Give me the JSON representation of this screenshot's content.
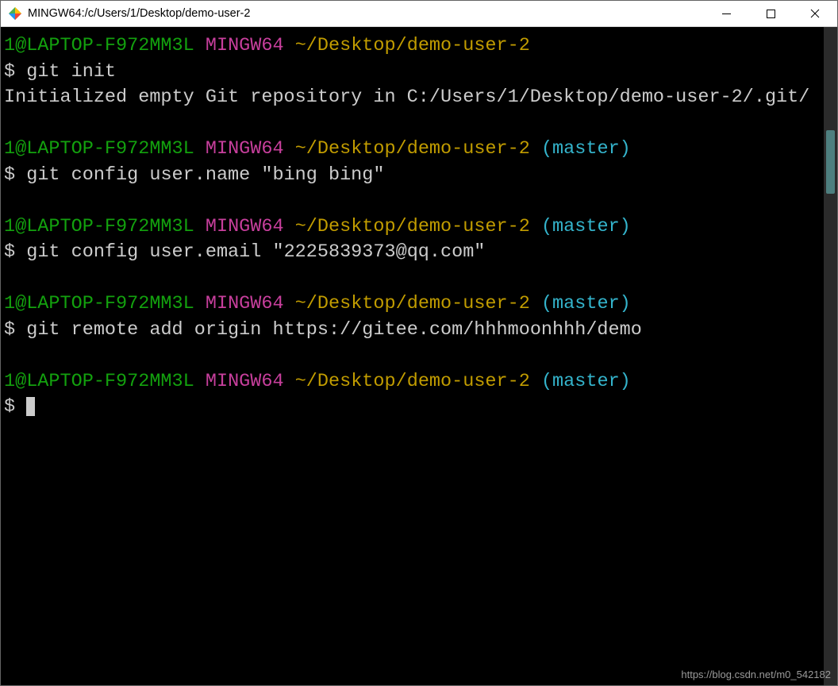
{
  "window": {
    "title": "MINGW64:/c/Users/1/Desktop/demo-user-2"
  },
  "prompt": {
    "user_host": "1@LAPTOP-F972MM3L",
    "env": "MINGW64",
    "path": "~/Desktop/demo-user-2",
    "branch": "(master)",
    "symbol": "$"
  },
  "blocks": [
    {
      "has_branch": false,
      "command": "git init",
      "output": "Initialized empty Git repository in C:/Users/1/Desktop/demo-user-2/.git/"
    },
    {
      "has_branch": true,
      "command": "git config user.name \"bing bing\"",
      "output": ""
    },
    {
      "has_branch": true,
      "command": "git config user.email \"2225839373@qq.com\"",
      "output": ""
    },
    {
      "has_branch": true,
      "command": "git remote add origin https://gitee.com/hhhmoonhhh/demo",
      "output": ""
    },
    {
      "has_branch": true,
      "command": "",
      "output": "",
      "cursor": true
    }
  ],
  "watermark": "https://blog.csdn.net/m0_542182"
}
